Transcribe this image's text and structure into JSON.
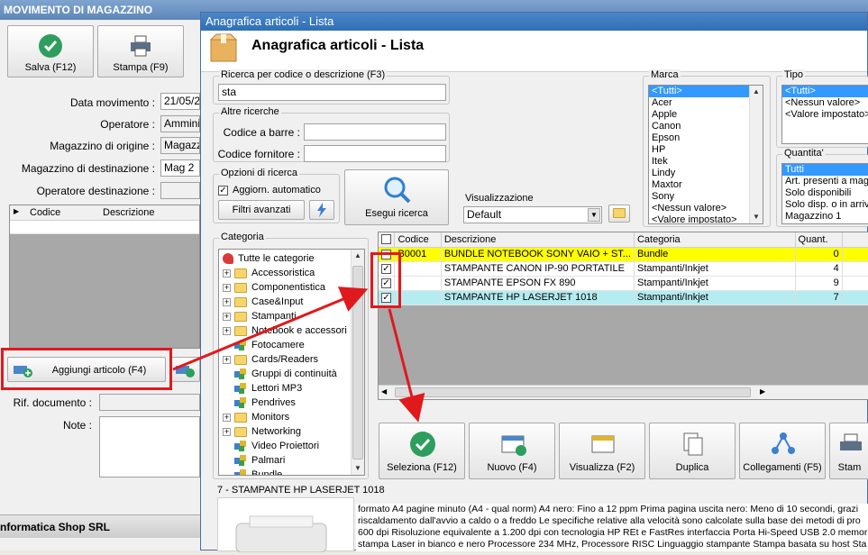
{
  "bg": {
    "title": "MOVIMENTO DI MAGAZZINO",
    "save_label": "Salva (F12)",
    "print_label": "Stampa (F9)",
    "date_label": "Data movimento :",
    "date_value": "21/05/20",
    "operator_label": "Operatore :",
    "operator_value": "Amminist",
    "origin_label": "Magazzino di origine :",
    "origin_value": "Magazzin",
    "dest_label": "Magazzino di destinazione :",
    "dest_value": "Mag 2",
    "dest_operator_label": "Operatore destinazione :",
    "grid_cols": [
      "Codice",
      "Descrizione"
    ],
    "add_article_label": "Aggiungi articolo (F4)",
    "doc_ref_label": "Rif. documento :",
    "notes_label": "Note :",
    "company": "nformatica Shop SRL"
  },
  "dialog": {
    "title": "Anagrafica articoli  - Lista",
    "header": "Anagrafica articoli  - Lista",
    "search_group": "Ricerca per codice o descrizione (F3)",
    "search_value": "sta",
    "other_group": "Altre ricerche",
    "barcode_label": "Codice a barre :",
    "supplier_code_label": "Codice fornitore :",
    "options_group": "Opzioni di ricerca",
    "auto_update_label": "Aggiorn. automatico",
    "advanced_filters_label": "Filtri avanzati",
    "search_button_label": "Esegui ricerca",
    "view_label": "Visualizzazione",
    "view_value": "Default",
    "brand_label": "Marca",
    "brands": [
      "<Tutti>",
      "Acer",
      "Apple",
      "Canon",
      "Epson",
      "HP",
      "Itek",
      "Lindy",
      "Maxtor",
      "Sony",
      "<Nessun valore>",
      "<Valore impostato>"
    ],
    "type_label": "Tipo",
    "types": [
      "<Tutti>",
      "<Nessun valore>",
      "<Valore impostato>"
    ],
    "quantity_label": "Quantita'",
    "quantities": [
      "Tutti",
      "Art. presenti a mag",
      "Solo disponibili",
      "Solo disp. o in arrivo",
      "Magazzino 1"
    ],
    "category_label": "Categoria",
    "categories_root": "Tutte le categorie",
    "categories": [
      {
        "label": "Accessoristica",
        "folder": true
      },
      {
        "label": "Componentistica",
        "folder": true
      },
      {
        "label": "Case&Input",
        "folder": true
      },
      {
        "label": "Stampanti",
        "folder": true
      },
      {
        "label": "Notebook e accessori",
        "folder": true
      },
      {
        "label": "Fotocamere",
        "folder": false
      },
      {
        "label": "Cards/Readers",
        "folder": true
      },
      {
        "label": "Gruppi di continuità",
        "folder": false
      },
      {
        "label": "Lettori MP3",
        "folder": false
      },
      {
        "label": "Pendrives",
        "folder": false
      },
      {
        "label": "Monitors",
        "folder": true
      },
      {
        "label": "Networking",
        "folder": true
      },
      {
        "label": "Video Proiettori",
        "folder": false
      },
      {
        "label": "Palmari",
        "folder": false
      },
      {
        "label": "Bundle",
        "folder": false
      }
    ],
    "grid_headers": [
      "Codice",
      "Descrizione",
      "Categoria",
      "Quant."
    ],
    "rows": [
      {
        "code": "B0001",
        "desc": "BUNDLE NOTEBOOK SONY VAIO + ST...",
        "cat": "Bundle",
        "qty": "0",
        "checked": false
      },
      {
        "code": "",
        "desc": "STAMPANTE CANON IP-90 PORTATILE",
        "cat": "Stampanti/Inkjet",
        "qty": "4",
        "checked": true
      },
      {
        "code": "",
        "desc": "STAMPANTE EPSON FX 890",
        "cat": "Stampanti/Inkjet",
        "qty": "9",
        "checked": true
      },
      {
        "code": "",
        "desc": "STAMPANTE HP LASERJET 1018",
        "cat": "Stampanti/Inkjet",
        "qty": "7",
        "checked": true
      }
    ],
    "actions": [
      "Seleziona (F12)",
      "Nuovo (F4)",
      "Visualizza (F2)",
      "Duplica",
      "Collegamenti (F5)",
      "Stam"
    ],
    "detail_title": "7 - STAMPANTE HP LASERJET 1018",
    "detail_text": "formato A4 pagine minuto (A4 - qual norm) A4 nero: Fino a 12 ppm Prima pagina uscita nero: Meno di 10 secondi, grazi riscaldamento dall'avvio a caldo o a freddo Le specifiche relative alla velocità sono calcolate sulla base dei metodi di pro 600 dpi Risoluzione equivalente a 1.200 dpi con tecnologia HP REt e FastRes interfaccia Porta Hi-Speed USB 2.0 memor stampa Laser in bianco e nero Processore 234 MHz, Processore RISC Linguaggio stampante Stampa basata su host Sta"
  },
  "colors": {
    "highlight_red": "#e0191d",
    "row_yellow": "#ffff00",
    "row_selected": "#b4ecf0",
    "list_select": "#3399ff"
  }
}
